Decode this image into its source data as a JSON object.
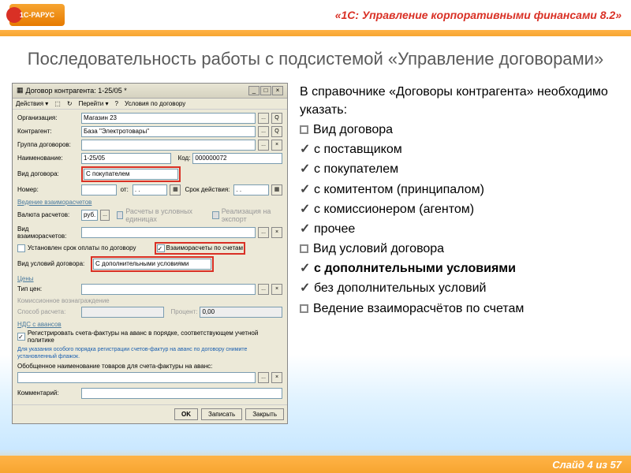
{
  "header": {
    "logo_text": "1С-РАРУС",
    "top_title": "«1С: Управление корпоративными финансами 8.2»"
  },
  "slide_title": "Последовательность работы с подсистемой «Управление договорами»",
  "window": {
    "title": "Договор контрагента: 1-25/05 *",
    "toolbar": {
      "actions": "Действия ▾",
      "goto": "Перейти ▾",
      "conditions": "Условия по договору"
    },
    "fields": {
      "org_lbl": "Организация:",
      "org_val": "Магазин 23",
      "contr_lbl": "Контрагент:",
      "contr_val": "База \"Электротовары\"",
      "group_lbl": "Группа договоров:",
      "group_val": "",
      "name_lbl": "Наименование:",
      "name_val": "1-25/05",
      "code_lbl": "Код:",
      "code_val": "000000072",
      "type_lbl": "Вид договора:",
      "type_val": "С покупателем",
      "num_lbl": "Номер:",
      "num_val": "",
      "from_lbl": "от:",
      "from_val": ". .",
      "term_lbl": "Срок действия:",
      "term_val": ". .",
      "section1": "Ведение взаиморасчетов",
      "curr_lbl": "Валюта расчетов:",
      "curr_val": "руб.",
      "chk_cond": "Расчеты в условных единицах",
      "chk_export": "Реализация на экспорт",
      "settl_lbl": "Вид взаиморасчетов:",
      "chk_deadline": "Установлен срок оплаты по договору",
      "chk_accounts": "Взаиморасчеты по счетам",
      "condtype_lbl": "Вид условий договора:",
      "condtype_val": "С дополнительными условиями",
      "section2": "Цены",
      "pricetype_lbl": "Тип цен:",
      "section3": "",
      "calc_lbl": "Способ расчета:",
      "percent_lbl": "Процент:",
      "percent_val": "0,00",
      "section4": "НДС с авансов",
      "chk_invoice": "Регистрировать счета-фактуры на аванс в порядке, соответствующем учетной политике",
      "blue_note": "Для указания особого порядка регистрации счетов-фактур на аванс по договору снимите установленный флажок.",
      "gen_name_lbl": "Обобщенное наименование товаров для счета-фактуры на аванс:",
      "comment_lbl": "Комментарий:"
    },
    "buttons": {
      "ok": "OK",
      "save": "Записать",
      "close": "Закрыть"
    }
  },
  "text": {
    "intro": "В справочнике «Договоры контрагента» необходимо указать:",
    "b1": "Вид договора",
    "c1": "с поставщиком",
    "c2": "с покупателем",
    "c3": "с  комитентом (принципалом)",
    "c4": "с комиссионером (агентом)",
    "c5": "прочее",
    "b2": "Вид условий договора",
    "c6": "с дополнительными условиями",
    "c7": "без дополнительных условий",
    "b3": "Ведение взаиморасчётов по счетам"
  },
  "footer": {
    "slide_num": "Слайд 4 из 57"
  }
}
